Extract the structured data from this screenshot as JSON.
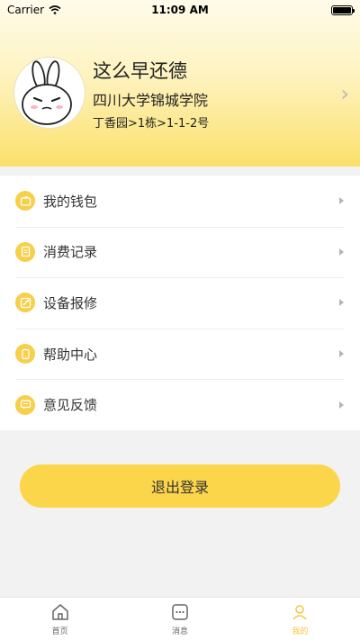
{
  "status_bar": {
    "carrier": "Carrier",
    "time": "11:09 AM"
  },
  "profile": {
    "name": "这么早还德",
    "school": "四川大学锦城学院",
    "room": "丁香园>1栋>1-1-2号"
  },
  "menu": {
    "items": [
      {
        "label": "我的钱包",
        "icon": "wallet-icon"
      },
      {
        "label": "消费记录",
        "icon": "receipt-icon"
      },
      {
        "label": "设备报修",
        "icon": "repair-icon"
      },
      {
        "label": "帮助中心",
        "icon": "phone-icon"
      },
      {
        "label": "意见反馈",
        "icon": "feedback-icon"
      }
    ]
  },
  "logout_label": "退出登录",
  "tabbar": {
    "tabs": [
      {
        "label": "首页",
        "icon": "home-icon",
        "active": false
      },
      {
        "label": "消息",
        "icon": "message-icon",
        "active": false
      },
      {
        "label": "我的",
        "icon": "user-icon",
        "active": true
      }
    ]
  },
  "colors": {
    "accent": "#fbd54a",
    "header_gradient_end": "#fbe06a",
    "icon_bg": "#f7cf4a"
  }
}
